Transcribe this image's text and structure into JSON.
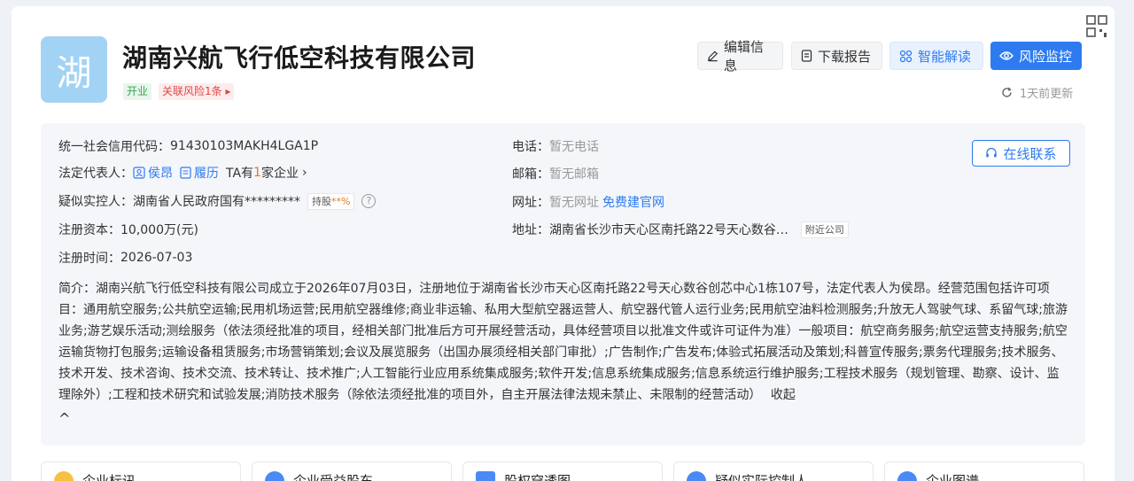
{
  "header": {
    "logo_char": "湖",
    "company_name": "湖南兴航飞行低空科技有限公司",
    "tags": {
      "status": "开业",
      "risk": "关联风险1条 ▸"
    },
    "buttons": {
      "edit": "编辑信息",
      "download": "下载报告",
      "ai": "智能解读",
      "monitor": "风险监控"
    },
    "update_text": "1天前更新"
  },
  "info": {
    "credit_code_label": "统一社会信用代码：",
    "credit_code": "91430103MAKH4LGA1P",
    "legal_rep_label": "法定代表人：",
    "legal_rep_name": "侯昂",
    "resume_label": "履历",
    "ta_prefix": "TA有",
    "ta_count": "1",
    "ta_suffix": "家企业",
    "controller_label": "疑似实控人：",
    "controller_value": "湖南省人民政府国有*********",
    "holding_label": "持股",
    "holding_pct": "**%",
    "capital_label": "注册资本：",
    "capital_value": "10,000万(元)",
    "reg_time_label": "注册时间：",
    "reg_time_value": "2026-07-03",
    "phone_label": "电话：",
    "phone_value": "暂无电话",
    "email_label": "邮箱：",
    "email_value": "暂无邮箱",
    "website_label": "网址：",
    "website_value": "暂无网址",
    "website_link": "免费建官网",
    "address_label": "地址：",
    "address_value": "湖南省长沙市天心区南托路22号天心数谷…",
    "nearby_label": "附近公司",
    "contact_button": "在线联系"
  },
  "summary": {
    "text": "简介：湖南兴航飞行低空科技有限公司成立于2026年07月03日，注册地位于湖南省长沙市天心区南托路22号天心数谷创芯中心1栋107号，法定代表人为侯昂。经营范围包括许可项目：通用航空服务;公共航空运输;民用机场运营;民用航空器维修;商业非运输、私用大型航空器运营人、航空器代管人运行业务;民用航空油料检测服务;升放无人驾驶气球、系留气球;旅游业务;游艺娱乐活动;测绘服务（依法须经批准的项目，经相关部门批准后方可开展经营活动，具体经营项目以批准文件或许可证件为准）一般项目：航空商务服务;航空运营支持服务;航空运输货物打包服务;运输设备租赁服务;市场营销策划;会议及展览服务（出国办展须经相关部门审批）;广告制作;广告发布;体验式拓展活动及策划;科普宣传服务;票务代理服务;技术服务、技术开发、技术咨询、技术交流、技术转让、技术推广;人工智能行业应用系统集成服务;软件开发;信息系统集成服务;信息系统运行维护服务;工程技术服务（规划管理、勘察、设计、监理除外）;工程和技术研究和试验发展;消防技术服务（除依法须经批准的项目外，自主开展法律法规未禁止、未限制的经营活动）",
    "collapse_label": "收起",
    "collapse_caret": "^"
  },
  "bottom_tabs": [
    "企业标讯",
    "企业受益股东",
    "股权穿透图",
    "疑似实际控制人",
    "企业图谱"
  ]
}
